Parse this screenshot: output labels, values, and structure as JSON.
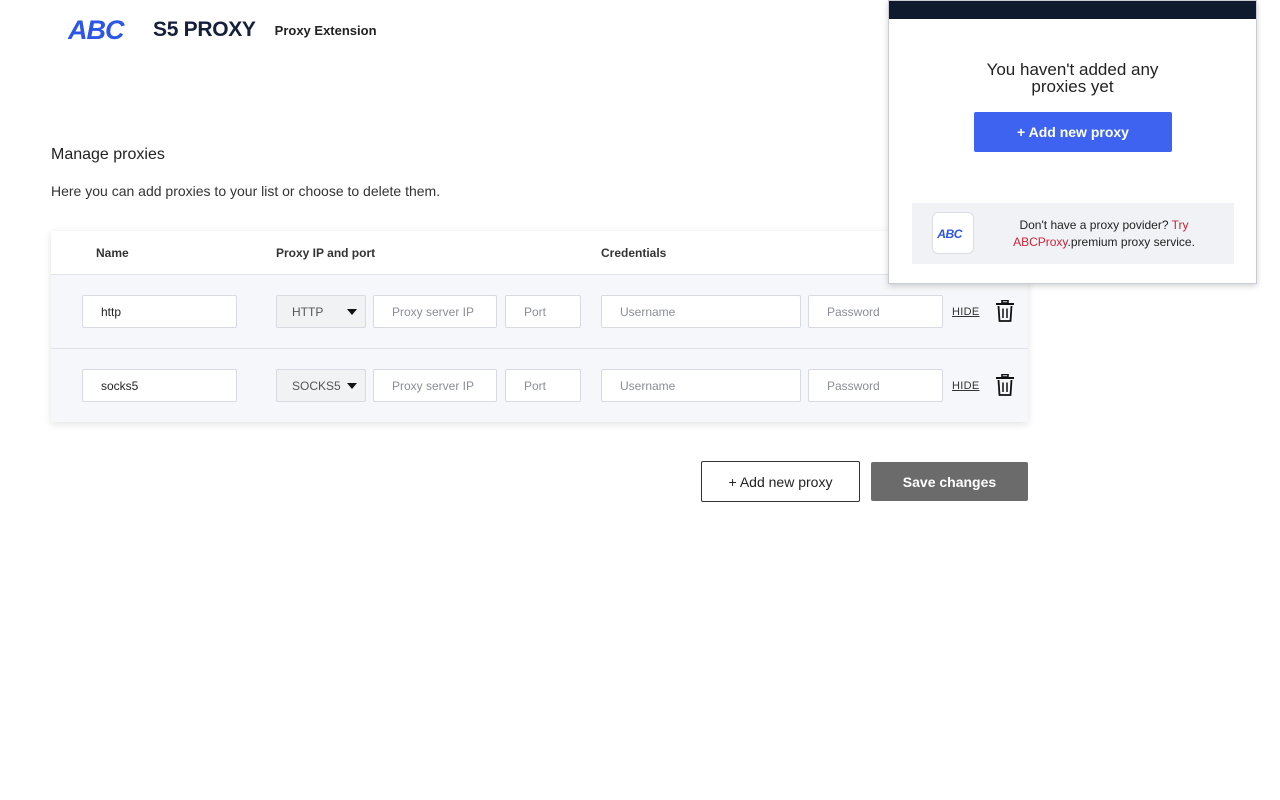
{
  "header": {
    "logo_text": "ABC",
    "brand": "S5 PROXY",
    "subtitle": "Proxy Extension"
  },
  "manage": {
    "title": "Manage proxies",
    "description": "Here you can add proxies to your list or choose to delete them."
  },
  "table": {
    "columns": [
      "Name",
      "Proxy IP and port",
      "Credentials"
    ],
    "rows": [
      {
        "name": "http",
        "protocol": "HTTP",
        "ip_placeholder": "Proxy server IP",
        "port_placeholder": "Port",
        "username_placeholder": "Username",
        "password_placeholder": "Password",
        "hide_label": "HIDE"
      },
      {
        "name": "socks5",
        "protocol": "SOCKS5",
        "ip_placeholder": "Proxy server IP",
        "port_placeholder": "Port",
        "username_placeholder": "Username",
        "password_placeholder": "Password",
        "hide_label": "HIDE"
      }
    ]
  },
  "actions": {
    "add_label": "+ Add new proxy",
    "save_label": "Save changes"
  },
  "popup": {
    "message": "You haven't added any proxies yet",
    "add_label": "+ Add new proxy",
    "promo_prefix": "Don't have a proxy povider? ",
    "promo_link": "Try ABCProxy",
    "promo_suffix": ".premium proxy service."
  },
  "colors": {
    "brand_blue": "#2d55e6",
    "primary_button": "#3e63f0",
    "save_button": "#6b6b6b",
    "popup_bar": "#0f1a2e",
    "promo_link": "#c8263a"
  },
  "icons": {
    "delete": "trash-icon",
    "dropdown": "caret-down-icon"
  }
}
